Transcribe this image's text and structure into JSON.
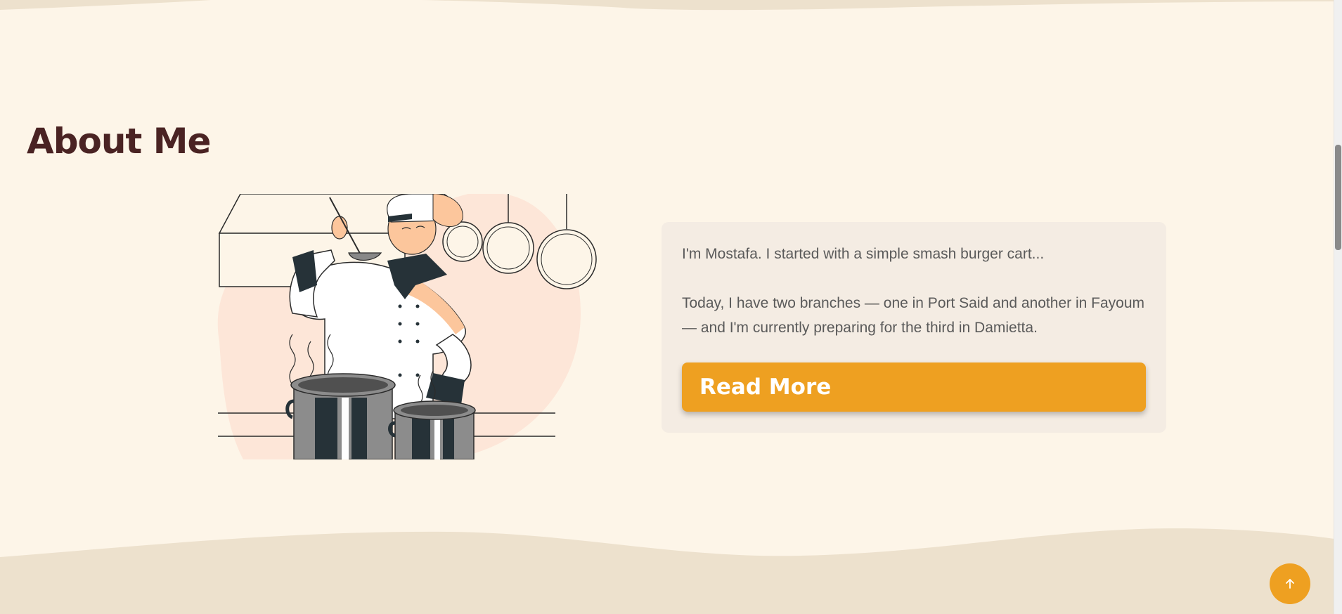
{
  "about": {
    "title": "About Me",
    "intro": "I'm Mostafa. I started with a simple smash burger cart...",
    "details": "Today, I have two branches — one in Port Said and another in Fayoum — and I'm currently preparing for the third in Damietta.",
    "read_more_label": "Read More"
  },
  "illustration": {
    "subject": "chef-tasting-soup-illustration"
  },
  "scroll_top": {
    "icon": "arrow-up-icon"
  },
  "colors": {
    "background": "#fdf5e8",
    "wave": "#ede1cd",
    "title": "#4a2323",
    "accent": "#eea021",
    "card": "#f4ece3",
    "text": "#5a5a5a"
  }
}
